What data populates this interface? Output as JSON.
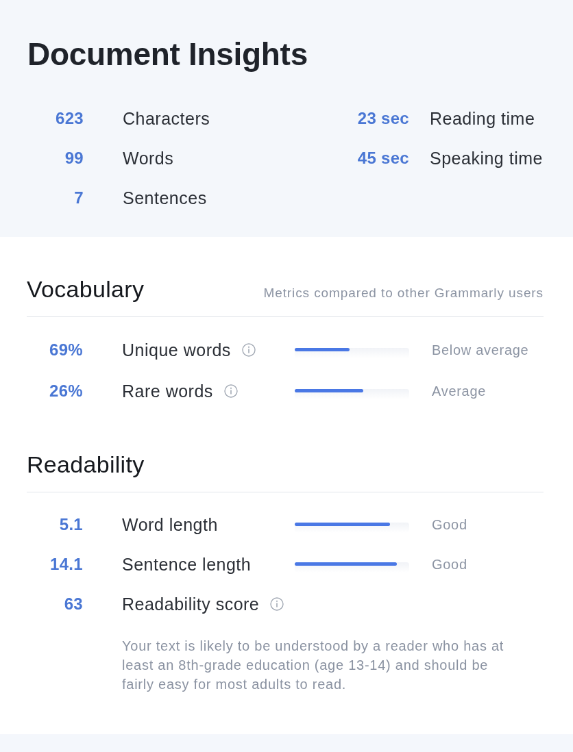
{
  "title": "Document Insights",
  "stats": {
    "left": [
      {
        "value": "623",
        "label": "Characters"
      },
      {
        "value": "99",
        "label": "Words"
      },
      {
        "value": "7",
        "label": "Sentences"
      }
    ],
    "right": [
      {
        "value": "23 sec",
        "label": "Reading time"
      },
      {
        "value": "45 sec",
        "label": "Speaking time"
      }
    ]
  },
  "vocabulary": {
    "heading": "Vocabulary",
    "note": "Metrics compared to other Grammarly users",
    "metrics": [
      {
        "kind": "bar",
        "value": "69%",
        "label": "Unique words",
        "info": true,
        "level": 0.48,
        "rating": "Below average"
      },
      {
        "kind": "bar",
        "value": "26%",
        "label": "Rare words",
        "info": true,
        "level": 0.6,
        "rating": "Average"
      }
    ]
  },
  "readability": {
    "heading": "Readability",
    "metrics": [
      {
        "kind": "bar",
        "value": "5.1",
        "label": "Word length",
        "info": false,
        "level": 0.83,
        "rating": "Good"
      },
      {
        "kind": "bar",
        "value": "14.1",
        "label": "Sentence length",
        "info": false,
        "level": 0.89,
        "rating": "Good"
      },
      {
        "kind": "score",
        "value": "63",
        "label": "Readability score",
        "info": true
      }
    ],
    "description": "Your text is likely to be understood by a reader who has at least an 8th-grade education (age 13-14) and should be fairly easy for most adults to read."
  }
}
